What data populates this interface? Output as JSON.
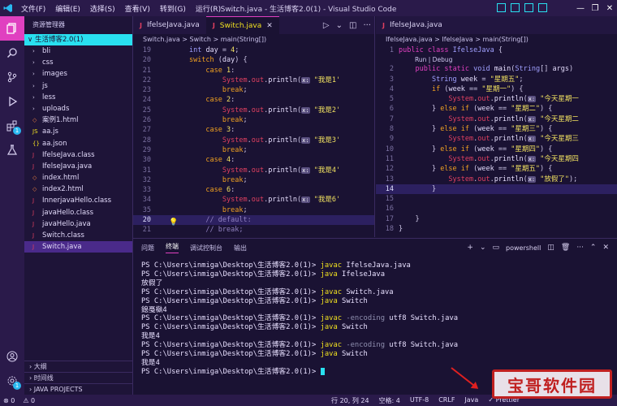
{
  "titlebar": {
    "title": "Switch.java - 生活博客2.0(1) - Visual Studio Code",
    "menu": [
      "文件(F)",
      "编辑(E)",
      "选择(S)",
      "查看(V)",
      "转到(G)",
      "运行(R)",
      "..."
    ]
  },
  "sidebar": {
    "header": "资源管理器",
    "root": "生活博客2.0(1)",
    "items": [
      {
        "label": "bli",
        "type": "folder"
      },
      {
        "label": "css",
        "type": "folder"
      },
      {
        "label": "images",
        "type": "folder"
      },
      {
        "label": "js",
        "type": "folder"
      },
      {
        "label": "less",
        "type": "folder"
      },
      {
        "label": "uploads",
        "type": "folder"
      },
      {
        "label": "案例1.html",
        "type": "html"
      },
      {
        "label": "aa.js",
        "type": "js"
      },
      {
        "label": "aa.json",
        "type": "json"
      },
      {
        "label": "IfelseJava.class",
        "type": "class"
      },
      {
        "label": "IfelseJava.java",
        "type": "java"
      },
      {
        "label": "index.html",
        "type": "html"
      },
      {
        "label": "index2.html",
        "type": "html"
      },
      {
        "label": "InnerjavaHello.class",
        "type": "class"
      },
      {
        "label": "javaHello.class",
        "type": "class"
      },
      {
        "label": "javaHello.java",
        "type": "java"
      },
      {
        "label": "Switch.class",
        "type": "class"
      },
      {
        "label": "Switch.java",
        "type": "java",
        "selected": true
      }
    ],
    "bottom": [
      "大纲",
      "时间线",
      "JAVA PROJECTS"
    ]
  },
  "editor_left": {
    "tabs": [
      "IfelseJava.java",
      "Switch.java"
    ],
    "active_tab": "Switch.java",
    "breadcrumb": "Switch.java > Switch > main(String[])",
    "lines": [
      {
        "n": "19",
        "html": "        <span class='ty'>int</span> <span class='txt'>day</span> = <span class='num'>4</span>;"
      },
      {
        "n": "20",
        "html": "        <span class='kw'>switch</span> (<span class='txt'>day</span>) {"
      },
      {
        "n": "21",
        "html": "            <span class='kw'>case</span> <span class='num'>1</span>:"
      },
      {
        "n": "22",
        "html": "                <span class='obj'>System</span>.<span class='obj'>out</span>.<span class='fn'>println</span>(<span class='hint'>x:</span> <span class='st'>\"我是1'</span>"
      },
      {
        "n": "23",
        "html": "                <span class='kw'>break</span>;"
      },
      {
        "n": "24",
        "html": "            <span class='kw'>case</span> <span class='num'>2</span>:"
      },
      {
        "n": "25",
        "html": "                <span class='obj'>System</span>.<span class='obj'>out</span>.<span class='fn'>println</span>(<span class='hint'>x:</span> <span class='st'>\"我是2'</span>"
      },
      {
        "n": "26",
        "html": "                <span class='kw'>break</span>;"
      },
      {
        "n": "27",
        "html": "            <span class='kw'>case</span> <span class='num'>3</span>:"
      },
      {
        "n": "28",
        "html": "                <span class='obj'>System</span>.<span class='obj'>out</span>.<span class='fn'>println</span>(<span class='hint'>x:</span> <span class='st'>\"我是3'</span>"
      },
      {
        "n": "29",
        "html": "                <span class='kw'>break</span>;"
      },
      {
        "n": "30",
        "html": "            <span class='kw'>case</span> <span class='num'>4</span>:"
      },
      {
        "n": "31",
        "html": "                <span class='obj'>System</span>.<span class='obj'>out</span>.<span class='fn'>println</span>(<span class='hint'>x:</span> <span class='st'>\"我是4'</span>"
      },
      {
        "n": "32",
        "html": "                <span class='kw'>break</span>;"
      },
      {
        "n": "33",
        "html": "            <span class='kw'>case</span> <span class='num'>6</span>:"
      },
      {
        "n": "34",
        "html": "                <span class='obj'>System</span>.<span class='obj'>out</span>.<span class='fn'>println</span>(<span class='hint'>x:</span> <span class='st'>\"我是6'</span>"
      },
      {
        "n": "35",
        "html": "                <span class='kw'>break</span>;"
      },
      {
        "n": "20",
        "html": "            <span class='cm'>// default:</span>",
        "current": true
      },
      {
        "n": "21",
        "html": "            <span class='cm'>// break;</span>"
      }
    ]
  },
  "editor_right": {
    "tabs": [
      "IfelseJava.java"
    ],
    "breadcrumb": "IfelseJava.java > IfelseJava > main(String[])",
    "codelens": "Run | Debug",
    "lines": [
      {
        "n": "1",
        "html": "<span class='kw2'>public</span> <span class='kw2'>class</span> <span class='ty'>IfelseJava</span> {"
      },
      {
        "n": "2",
        "html": "    <span class='kw2'>public</span> <span class='kw2'>static</span> <span class='ty'>void</span> <span class='fn'>main</span>(<span class='ty'>String</span>[] <span class='txt'>args</span>)"
      },
      {
        "n": "3",
        "html": "        <span class='ty'>String</span> <span class='txt'>week</span> = <span class='st'>\"星期五\"</span>;"
      },
      {
        "n": "4",
        "html": "        <span class='kw'>if</span> (<span class='txt'>week</span> == <span class='st'>\"星期一\"</span>) {"
      },
      {
        "n": "5",
        "html": "            <span class='obj'>System</span>.<span class='obj'>out</span>.<span class='fn'>println</span>(<span class='hint'>x:</span> <span class='st'>\"今天星期一</span>"
      },
      {
        "n": "6",
        "html": "        } <span class='kw'>else if</span> (<span class='txt'>week</span> == <span class='st'>\"星期二\"</span>) {"
      },
      {
        "n": "7",
        "html": "            <span class='obj'>System</span>.<span class='obj'>out</span>.<span class='fn'>println</span>(<span class='hint'>x:</span> <span class='st'>\"今天星期二</span>"
      },
      {
        "n": "8",
        "html": "        } <span class='kw'>else if</span> (<span class='txt'>week</span> == <span class='st'>\"星期三\"</span>) {"
      },
      {
        "n": "9",
        "html": "            <span class='obj'>System</span>.<span class='obj'>out</span>.<span class='fn'>println</span>(<span class='hint'>x:</span> <span class='st'>\"今天星期三</span>"
      },
      {
        "n": "10",
        "html": "        } <span class='kw'>else if</span> (<span class='txt'>week</span> == <span class='st'>\"星期四\"</span>) {"
      },
      {
        "n": "11",
        "html": "            <span class='obj'>System</span>.<span class='obj'>out</span>.<span class='fn'>println</span>(<span class='hint'>x:</span> <span class='st'>\"今天星期四</span>"
      },
      {
        "n": "12",
        "html": "        } <span class='kw'>else if</span> (<span class='txt'>week</span> == <span class='st'>\"星期五\"</span>) {"
      },
      {
        "n": "13",
        "html": "            <span class='obj'>System</span>.<span class='obj'>out</span>.<span class='fn'>println</span>(<span class='hint'>x:</span> <span class='st'>\"放假了\"</span>);"
      },
      {
        "n": "14",
        "html": "        }",
        "current": true
      },
      {
        "n": "15",
        "html": ""
      },
      {
        "n": "16",
        "html": ""
      },
      {
        "n": "17",
        "html": "    }"
      },
      {
        "n": "18",
        "html": "}"
      }
    ]
  },
  "panel": {
    "tabs": [
      "问题",
      "终端",
      "调试控制台",
      "输出"
    ],
    "active_tab": "终端",
    "shell": "powershell",
    "terminal": [
      {
        "prompt": "PS C:\\Users\\inmiga\\Desktop\\生活博客2.0(1)> ",
        "cmd": "javac",
        "args": " IfelseJava.java"
      },
      {
        "prompt": "PS C:\\Users\\inmiga\\Desktop\\生活博客2.0(1)> ",
        "cmd": "java",
        "args": " IfelseJava"
      },
      {
        "out": "放假了"
      },
      {
        "prompt": "PS C:\\Users\\inmiga\\Desktop\\生活博客2.0(1)> ",
        "cmd": "javac",
        "args": " Switch.java"
      },
      {
        "prompt": "PS C:\\Users\\inmiga\\Desktop\\生活博客2.0(1)> ",
        "cmd": "java",
        "args": " Switch"
      },
      {
        "out": "鎴戞槸4"
      },
      {
        "prompt": "PS C:\\Users\\inmiga\\Desktop\\生活博客2.0(1)> ",
        "cmd": "javac",
        "flag": " -encoding",
        "args": " utf8 Switch.java"
      },
      {
        "prompt": "PS C:\\Users\\inmiga\\Desktop\\生活博客2.0(1)> ",
        "cmd": "java",
        "args": " Switch"
      },
      {
        "out": "我是4"
      },
      {
        "prompt": "PS C:\\Users\\inmiga\\Desktop\\生活博客2.0(1)> ",
        "cmd": "javac",
        "flag": " -encoding",
        "args": " utf8 Switch.java"
      },
      {
        "prompt": "PS C:\\Users\\inmiga\\Desktop\\生活博客2.0(1)> ",
        "cmd": "java",
        "args": " Switch"
      },
      {
        "out": "我是4"
      },
      {
        "prompt": "PS C:\\Users\\inmiga\\Desktop\\生活博客2.0(1)> ",
        "cursor": true
      }
    ]
  },
  "statusbar": {
    "errors": "⊗ 0",
    "warnings": "⚠ 0",
    "position": "行 20, 列 24",
    "spaces": "空格: 4",
    "encoding": "UTF-8",
    "eol": "CRLF",
    "language": "Java",
    "formatter": "✓ Prettier"
  },
  "watermark": "宝哥软件园",
  "colors": {
    "accent": "#e040c0",
    "cyan": "#29e0f0",
    "bg": "#1a1233"
  }
}
